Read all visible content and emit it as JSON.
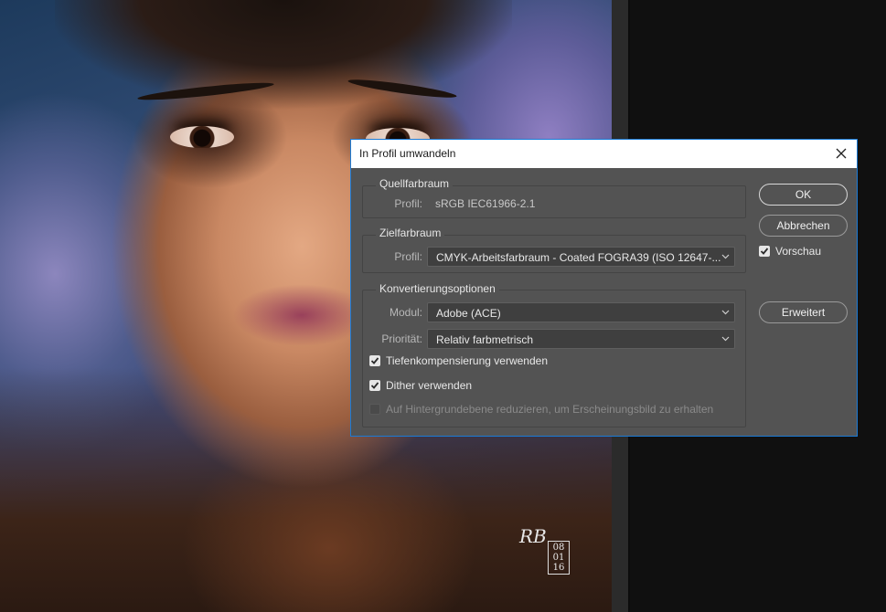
{
  "dialog": {
    "title": "In Profil umwandeln",
    "close_icon": "close-icon",
    "source": {
      "legend": "Quellfarbraum",
      "profile_label": "Profil:",
      "profile_value": "sRGB IEC61966-2.1"
    },
    "target": {
      "legend": "Zielfarbraum",
      "profile_label": "Profil:",
      "profile_selected": "CMYK-Arbeitsfarbraum - Coated FOGRA39 (ISO 12647-..."
    },
    "options": {
      "legend": "Konvertierungsoptionen",
      "module_label": "Modul:",
      "module_selected": "Adobe (ACE)",
      "priority_label": "Priorität:",
      "priority_selected": "Relativ farbmetrisch",
      "black_point": {
        "label": "Tiefenkompensierung verwenden",
        "checked": true
      },
      "dither": {
        "label": "Dither verwenden",
        "checked": true
      },
      "flatten": {
        "label": "Auf Hintergrundebene reduzieren, um Erscheinungsbild zu erhalten",
        "checked": false,
        "enabled": false
      }
    },
    "buttons": {
      "ok": "OK",
      "cancel": "Abbrechen",
      "advanced": "Erweitert"
    },
    "preview": {
      "label": "Vorschau",
      "checked": true
    }
  },
  "artwork": {
    "signature_initials": "RB",
    "signature_date_day": "08",
    "signature_date_month": "01",
    "signature_date_year": "16"
  },
  "colors": {
    "dialog_bg": "#535353",
    "dialog_border": "#1b7bd6",
    "titlebar_bg": "#ffffff",
    "workspace_bg": "#101010"
  }
}
